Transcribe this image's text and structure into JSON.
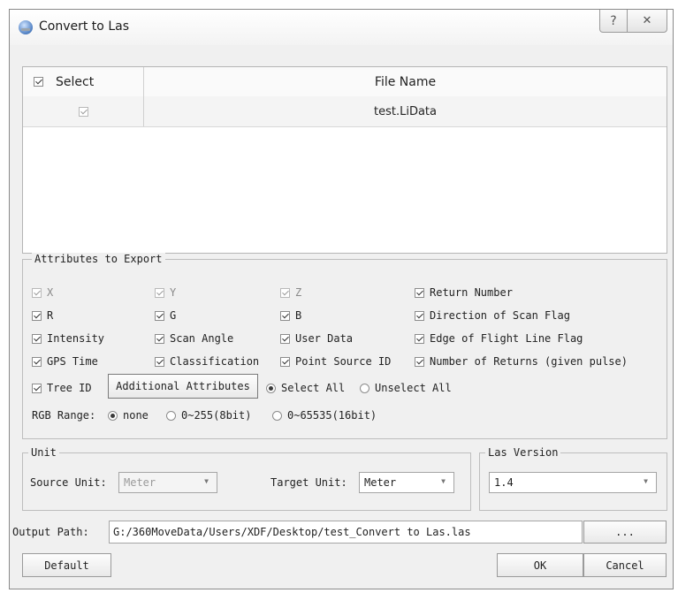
{
  "window": {
    "title": "Convert to Las",
    "help_glyph": "?",
    "close_glyph": "✕"
  },
  "file_table": {
    "columns": [
      "Select",
      "File Name"
    ],
    "header_checked": true,
    "rows": [
      {
        "checked": true,
        "file_name": "test.LiData"
      }
    ]
  },
  "attributes": {
    "legend": "Attributes to Export",
    "items": [
      {
        "label": "X",
        "checked": true,
        "enabled": false
      },
      {
        "label": "Y",
        "checked": true,
        "enabled": false
      },
      {
        "label": "Z",
        "checked": true,
        "enabled": false
      },
      {
        "label": "Return Number",
        "checked": true,
        "enabled": true
      },
      {
        "label": "R",
        "checked": true,
        "enabled": true
      },
      {
        "label": "G",
        "checked": true,
        "enabled": true
      },
      {
        "label": "B",
        "checked": true,
        "enabled": true
      },
      {
        "label": "Direction of Scan Flag",
        "checked": true,
        "enabled": true
      },
      {
        "label": "Intensity",
        "checked": true,
        "enabled": true
      },
      {
        "label": "Scan Angle",
        "checked": true,
        "enabled": true
      },
      {
        "label": "User Data",
        "checked": true,
        "enabled": true
      },
      {
        "label": "Edge of Flight Line Flag",
        "checked": true,
        "enabled": true
      },
      {
        "label": "GPS Time",
        "checked": true,
        "enabled": true
      },
      {
        "label": "Classification",
        "checked": true,
        "enabled": true
      },
      {
        "label": "Point Source ID",
        "checked": true,
        "enabled": true
      },
      {
        "label": "Number of Returns (given pulse)",
        "checked": true,
        "enabled": true
      },
      {
        "label": "Tree ID",
        "checked": true,
        "enabled": true
      }
    ],
    "additional_button": "Additional Attributes",
    "select_all": {
      "label": "Select All",
      "checked": true
    },
    "unselect_all": {
      "label": "Unselect All",
      "checked": false
    },
    "rgb_range": {
      "label": "RGB Range:",
      "options": [
        {
          "label": "none",
          "checked": true
        },
        {
          "label": "0~255(8bit)",
          "checked": false
        },
        {
          "label": "0~65535(16bit)",
          "checked": false
        }
      ]
    }
  },
  "unit": {
    "legend": "Unit",
    "source_label": "Source Unit:",
    "source_value": "Meter",
    "target_label": "Target Unit:",
    "target_value": "Meter"
  },
  "las_version": {
    "legend": "Las Version",
    "value": "1.4"
  },
  "output": {
    "label": "Output Path:",
    "path": "G:/360MoveData/Users/XDF/Desktop/test_Convert to Las.las",
    "browse_label": "..."
  },
  "buttons": {
    "default": "Default",
    "ok": "OK",
    "cancel": "Cancel"
  },
  "colors": {
    "dialog_bg": "#f0f0f0",
    "border": "#bdbdbd"
  }
}
